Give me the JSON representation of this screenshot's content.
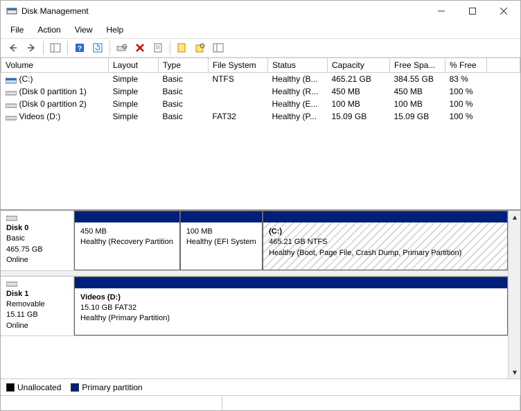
{
  "window": {
    "title": "Disk Management"
  },
  "menu": [
    "File",
    "Action",
    "View",
    "Help"
  ],
  "columns": [
    "Volume",
    "Layout",
    "Type",
    "File System",
    "Status",
    "Capacity",
    "Free Spa...",
    "% Free"
  ],
  "volumes": [
    {
      "icon": "drive",
      "name": "(C:)",
      "layout": "Simple",
      "type": "Basic",
      "fs": "NTFS",
      "status": "Healthy (B...",
      "capacity": "465.21 GB",
      "free": "384.55 GB",
      "pct": "83 %"
    },
    {
      "icon": "part",
      "name": "(Disk 0 partition 1)",
      "layout": "Simple",
      "type": "Basic",
      "fs": "",
      "status": "Healthy (R...",
      "capacity": "450 MB",
      "free": "450 MB",
      "pct": "100 %"
    },
    {
      "icon": "part",
      "name": "(Disk 0 partition 2)",
      "layout": "Simple",
      "type": "Basic",
      "fs": "",
      "status": "Healthy (E...",
      "capacity": "100 MB",
      "free": "100 MB",
      "pct": "100 %"
    },
    {
      "icon": "part",
      "name": "Videos (D:)",
      "layout": "Simple",
      "type": "Basic",
      "fs": "FAT32",
      "status": "Healthy (P...",
      "capacity": "15.09 GB",
      "free": "15.09 GB",
      "pct": "100 %"
    }
  ],
  "disks": [
    {
      "name": "Disk 0",
      "kind": "Basic",
      "size": "465.75 GB",
      "state": "Online",
      "parts": [
        {
          "label": "",
          "line2": "450 MB",
          "line3": "Healthy (Recovery Partition",
          "flex": 18,
          "hatched": false
        },
        {
          "label": "",
          "line2": "100 MB",
          "line3": "Healthy (EFI System",
          "flex": 14,
          "hatched": false
        },
        {
          "label": "(C:)",
          "line2": "465.21 GB NTFS",
          "line3": "Healthy (Boot, Page File, Crash Dump, Primary Partition)",
          "flex": 42,
          "hatched": true
        }
      ]
    },
    {
      "name": "Disk 1",
      "kind": "Removable",
      "size": "15.11 GB",
      "state": "Online",
      "parts": [
        {
          "label": "Videos  (D:)",
          "line2": "15.10 GB FAT32",
          "line3": "Healthy (Primary Partition)",
          "flex": 60,
          "hatched": false
        }
      ]
    }
  ],
  "legend": {
    "unallocated": "Unallocated",
    "primary": "Primary partition"
  }
}
